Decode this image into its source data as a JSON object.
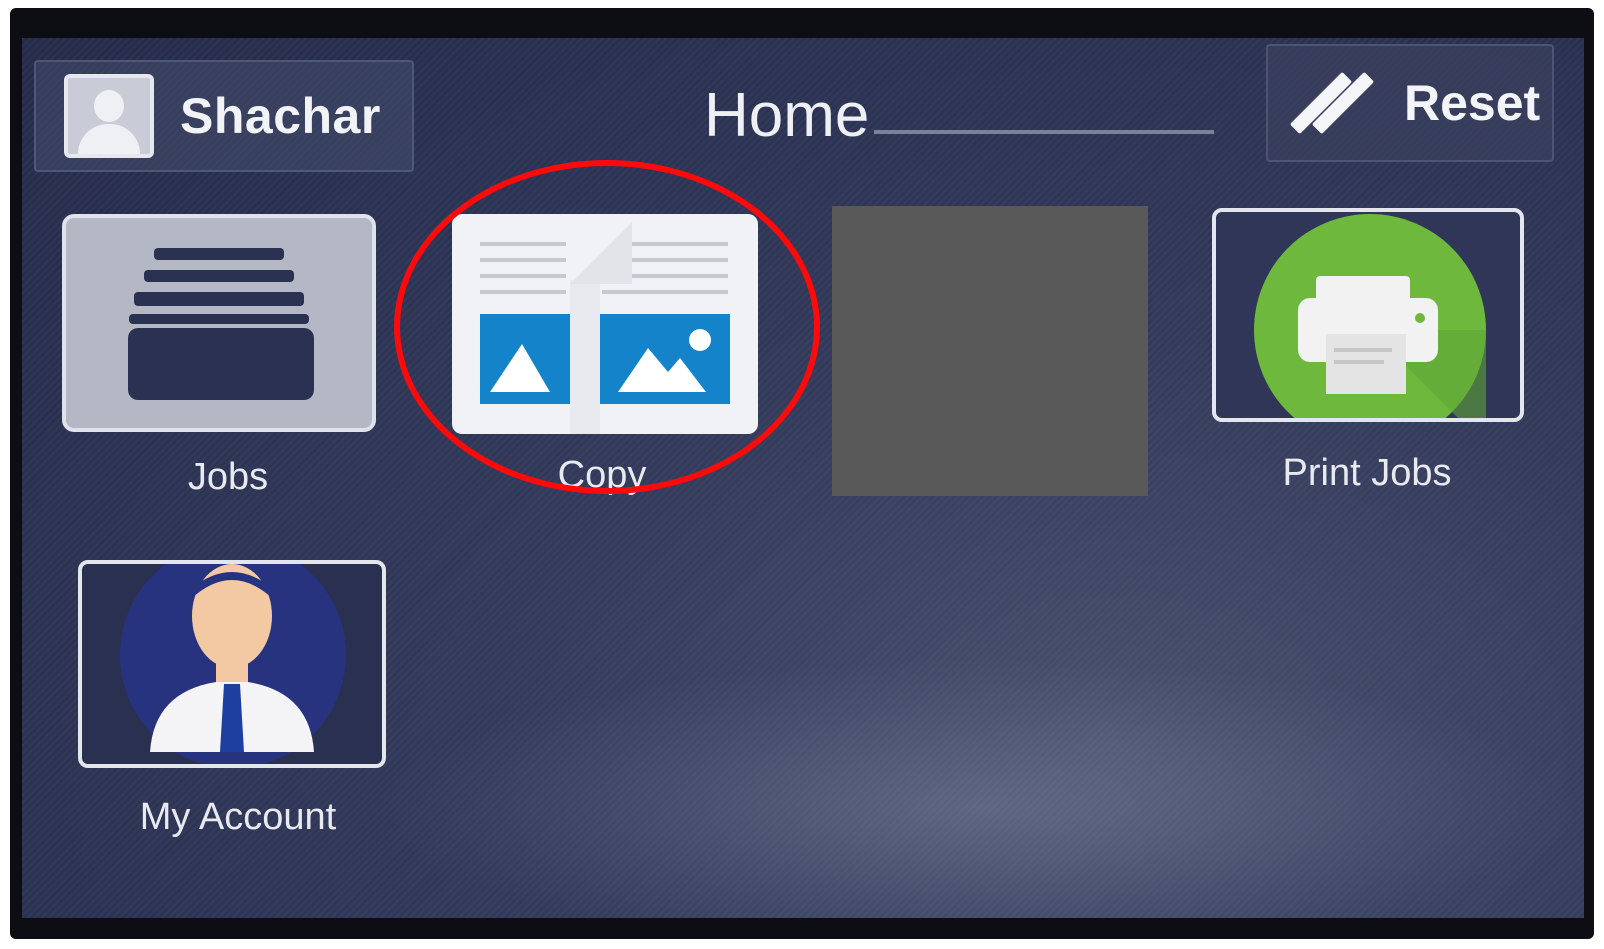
{
  "header": {
    "user_name": "Shachar",
    "title": "Home",
    "reset_label": "Reset"
  },
  "tiles": [
    {
      "label": "Jobs",
      "icon": "file-drawer-icon"
    },
    {
      "label": "Copy",
      "icon": "copy-document-icon"
    },
    {
      "label": "",
      "icon": "redacted-block"
    },
    {
      "label": "Print Jobs",
      "icon": "printer-icon"
    },
    {
      "label": "My Account",
      "icon": "user-account-icon"
    }
  ],
  "annotation": {
    "highlight_color": "#ff0a0a",
    "highlighted_tile": "Copy"
  },
  "colors": {
    "screen_bg": "#2c3354",
    "copy_image_blue": "#1583c9",
    "printer_green": "#6db83d",
    "redacted_gray": "#595959"
  }
}
